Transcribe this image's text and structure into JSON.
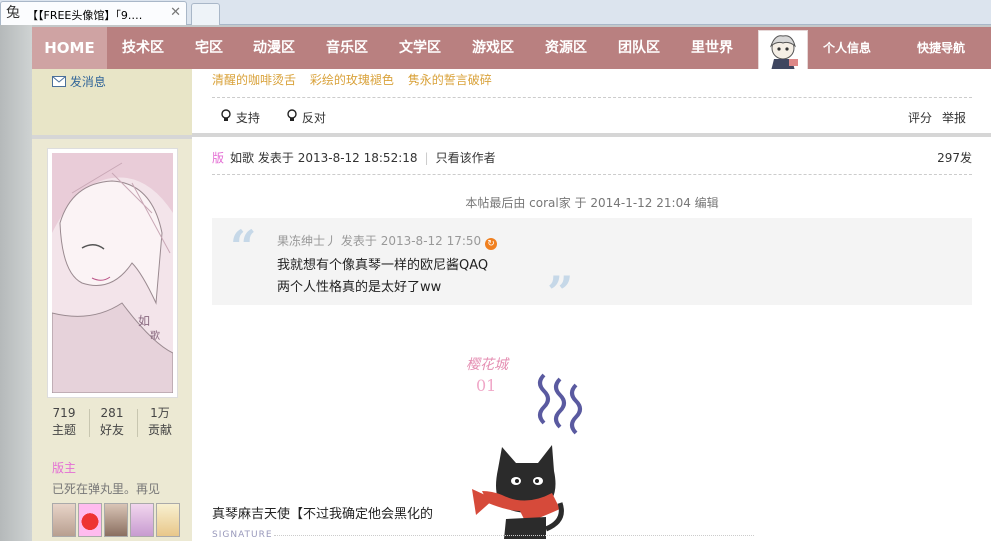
{
  "browser": {
    "tab_favicon": "兔",
    "tab_title": "【【FREE头像馆】「9.…",
    "tab_close": "✕"
  },
  "nav": {
    "home": "HOME",
    "items": [
      "技术区",
      "宅区",
      "动漫区",
      "音乐区",
      "文学区",
      "游戏区",
      "资源区",
      "团队区",
      "里世界"
    ],
    "profile": "个人信息",
    "quick_nav": "快捷导航"
  },
  "sidebar": {
    "send_message": "发消息",
    "stats": [
      {
        "value": "719",
        "label": "主题"
      },
      {
        "value": "281",
        "label": "好友"
      },
      {
        "value": "1万",
        "label": "贡献"
      }
    ],
    "role": "版主",
    "custom_title": "已死在弹丸里。再见",
    "avatar_watermark": [
      "如",
      "歌"
    ]
  },
  "prev_post": {
    "signature": [
      "清醒的咖啡烫舌",
      "彩绘的玫瑰褪色",
      "隽永的誓言破碎"
    ],
    "support": "支持",
    "oppose": "反对",
    "rate": "评分",
    "report": "举报"
  },
  "post": {
    "badge": "版",
    "author": "如歌",
    "posted_prefix": "发表于",
    "date": "2013-8-12 18:52:18",
    "only_author": "只看该作者",
    "floor": "297发",
    "edited_note": "本帖最后由 coral家 于 2014-1-12 21:04 编辑",
    "quote": {
      "author": "果冻绅士丿",
      "posted_prefix": "发表于",
      "date": "2013-8-12 17:50",
      "back_icon": "↻",
      "lines": [
        "我就想有个像真琴一样的欧尼酱QAQ",
        "两个人性格真的是太好了ww"
      ]
    },
    "sticker_caption": "樱花城",
    "sticker_number": "01",
    "body": "真琴麻吉天使【不过我确定他会黑化的",
    "signature_label": "SIGNATURE"
  }
}
